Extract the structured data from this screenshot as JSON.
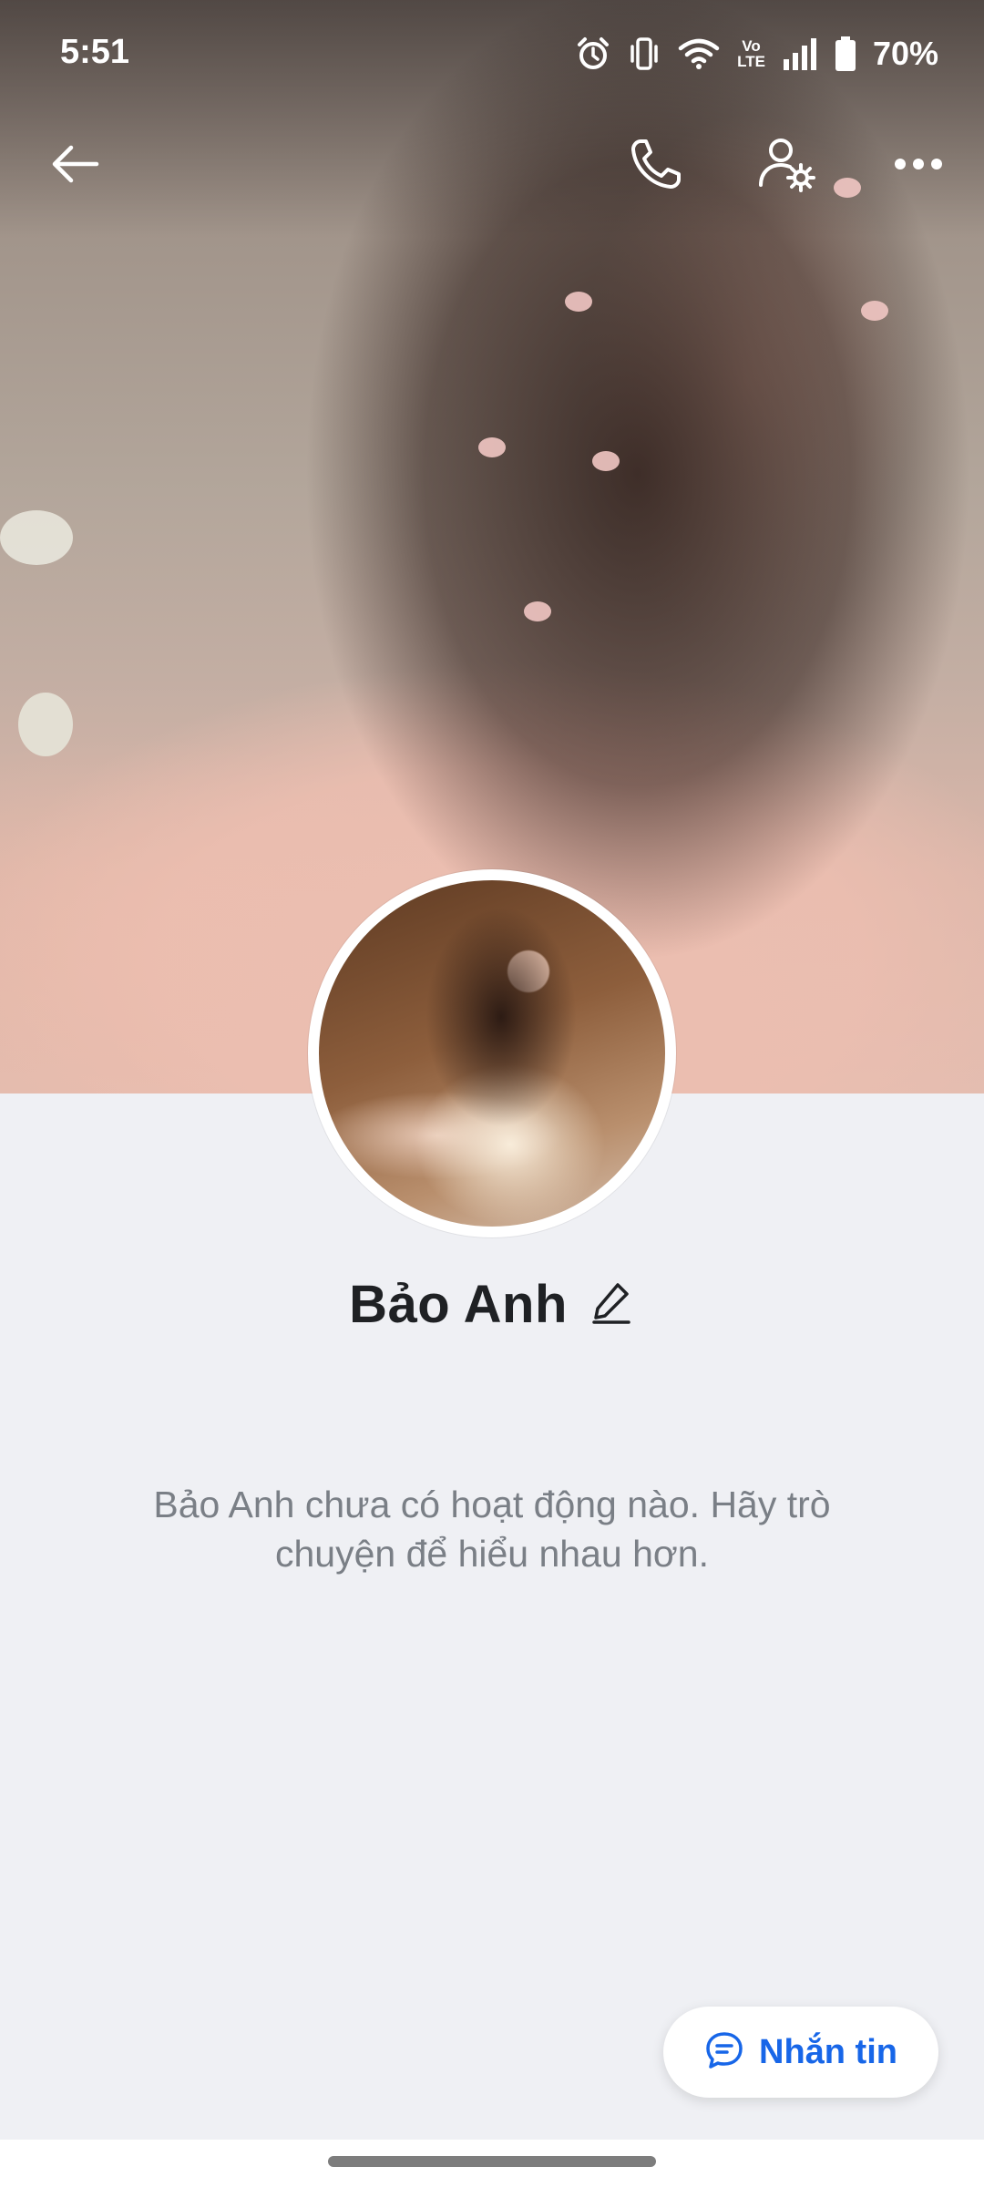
{
  "status_bar": {
    "time": "5:51",
    "battery": "70%",
    "icons": [
      "alarm-icon",
      "vibrate-icon",
      "wifi-icon",
      "volte-icon",
      "signal-icon",
      "battery-icon"
    ],
    "volte_label_top": "Vo",
    "volte_label_bottom": "LTE"
  },
  "topbar": {
    "icons": [
      "back-arrow-icon",
      "phone-icon",
      "user-settings-icon",
      "more-dots-icon"
    ]
  },
  "profile": {
    "name": "Bảo Anh",
    "empty_message": "Bảo Anh chưa có hoạt động nào. Hãy trò chuyện để hiểu nhau hơn."
  },
  "actions": {
    "message_label": "Nhắn tin"
  },
  "colors": {
    "background": "#eff0f4",
    "accent": "#1766e8",
    "name_text": "#1f2124",
    "muted_text": "#7a7f86"
  }
}
